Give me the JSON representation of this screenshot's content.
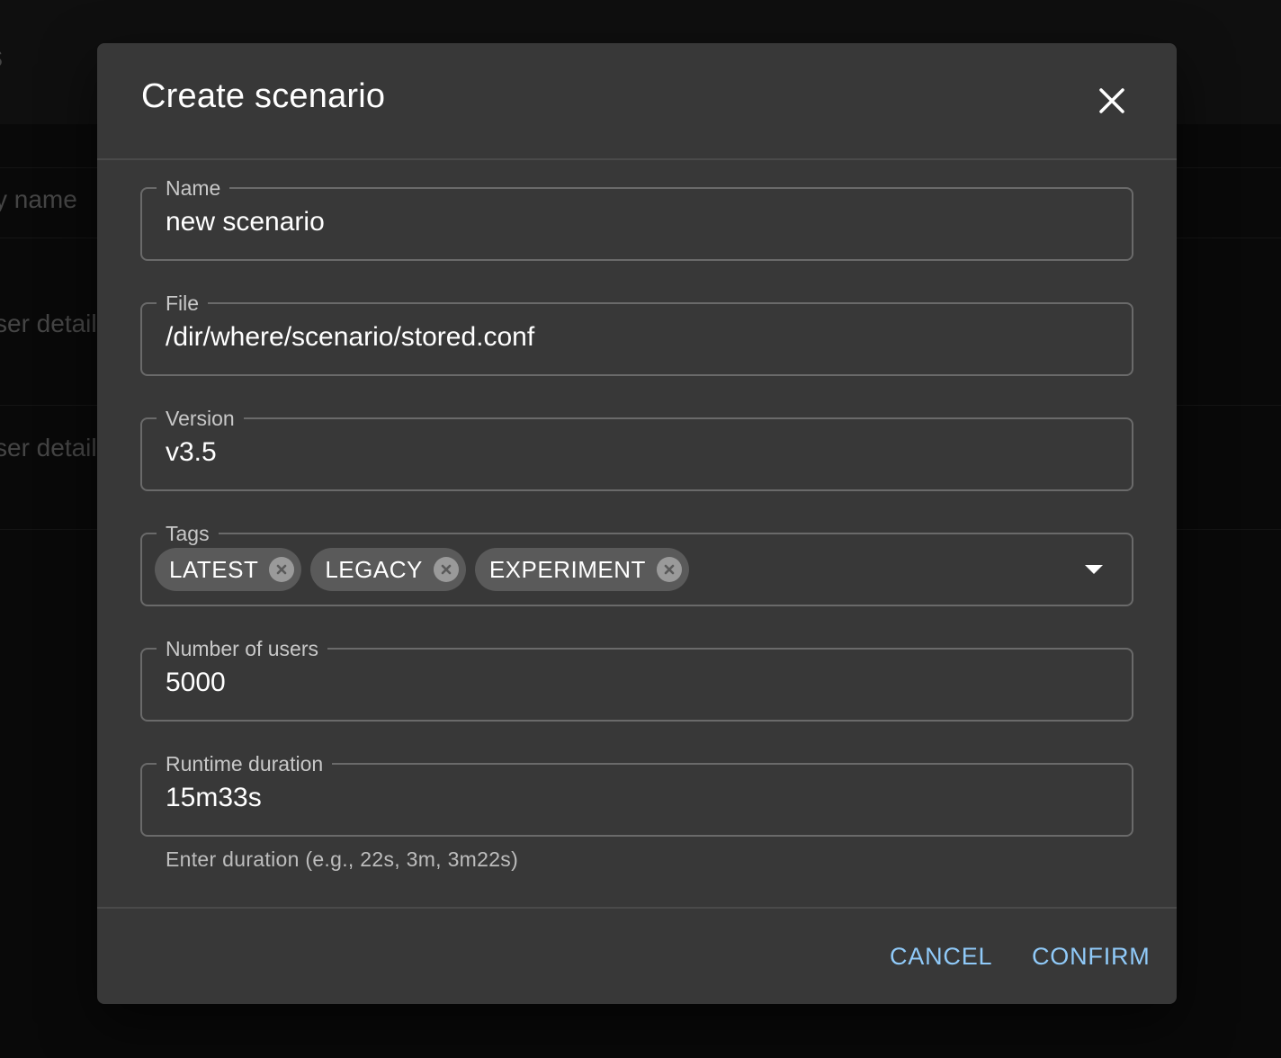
{
  "background": {
    "header_text": "s",
    "rows": [
      "y name",
      "ser detail",
      "ser detail"
    ]
  },
  "dialog": {
    "title": "Create scenario",
    "close_icon": "close-icon"
  },
  "form": {
    "name": {
      "label": "Name",
      "value": "new scenario"
    },
    "file": {
      "label": "File",
      "value": "/dir/where/scenario/stored.conf"
    },
    "version": {
      "label": "Version",
      "value": "v3.5"
    },
    "tags": {
      "label": "Tags",
      "chips": [
        "LATEST",
        "LEGACY",
        "EXPERIMENT"
      ],
      "dropdown_icon": "arrow-drop-down-icon"
    },
    "users": {
      "label": "Number of users",
      "value": "5000"
    },
    "runtime": {
      "label": "Runtime duration",
      "value": "15m33s",
      "helper": "Enter duration (e.g., 22s, 3m, 3m22s)"
    }
  },
  "actions": {
    "cancel_label": "CANCEL",
    "confirm_label": "CONFIRM"
  },
  "colors": {
    "dialog_bg": "#383838",
    "accent": "#90caf9",
    "chip_bg": "#5a5a5a"
  }
}
